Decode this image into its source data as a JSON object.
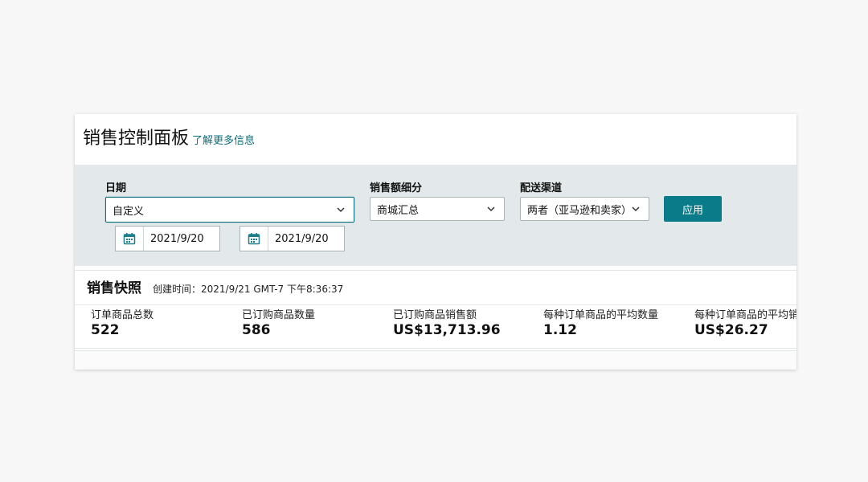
{
  "header": {
    "title": "销售控制面板",
    "learn_more": "了解更多信息"
  },
  "filters": {
    "date": {
      "label": "日期",
      "selected": "自定义",
      "start": "2021/9/20",
      "end": "2021/9/20"
    },
    "breakdown": {
      "label": "销售额细分",
      "selected": "商城汇总"
    },
    "channel": {
      "label": "配送渠道",
      "selected": "两者（亚马逊和卖家）"
    },
    "apply_label": "应用"
  },
  "snapshot": {
    "title": "销售快照",
    "created": "创建时间：2021/9/21 GMT-7 下午8:36:37",
    "metrics": [
      {
        "label": "订单商品总数",
        "value": "522"
      },
      {
        "label": "已订购商品数量",
        "value": "586"
      },
      {
        "label": "已订购商品销售额",
        "value": "US$13,713.96"
      },
      {
        "label": "每种订单商品的平均数量",
        "value": "1.12"
      },
      {
        "label": "每种订单商品的平均销售额",
        "value": "US$26.27"
      }
    ]
  },
  "colors": {
    "accent": "#0a7b88",
    "panel": "#e3e9ea",
    "link": "#0a6f7f"
  },
  "icons": {
    "dropdown": "chevron-down-icon",
    "date": "calendar-icon"
  }
}
